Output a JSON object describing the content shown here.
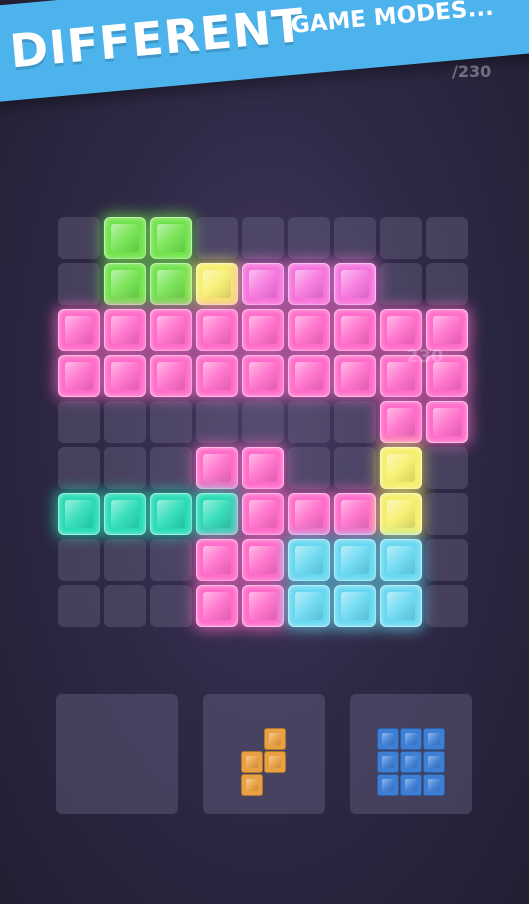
{
  "banner": {
    "headline": "DIFFERENT",
    "subline": "GAME MODES..."
  },
  "hud": {
    "score_partial": "/230",
    "float_score": "230"
  },
  "colors": {
    "G": "#6fe34a",
    "Y": "#f6ef6a",
    "P": "#f673dd",
    "K": "#ff6ac9",
    "T": "#26dcb5",
    "C": "#66d8f1",
    "O": "#e9a042",
    "B": "#3e7fd6"
  },
  "board": {
    "rows": [
      "_GG______",
      "_GGYPPP__",
      "KKKKKKKKK",
      "KKKKKKKKK",
      "_______KK",
      "___KK__Y_",
      "TTTTKKKY_",
      "___KKCCC_",
      "___KKCCC_"
    ]
  },
  "tray": [
    {
      "piece": []
    },
    {
      "piece": [
        "_O",
        "OO",
        "O_"
      ],
      "color": "O"
    },
    {
      "piece": [
        "BBB",
        "BBB",
        "BBB"
      ],
      "color": "B"
    }
  ]
}
